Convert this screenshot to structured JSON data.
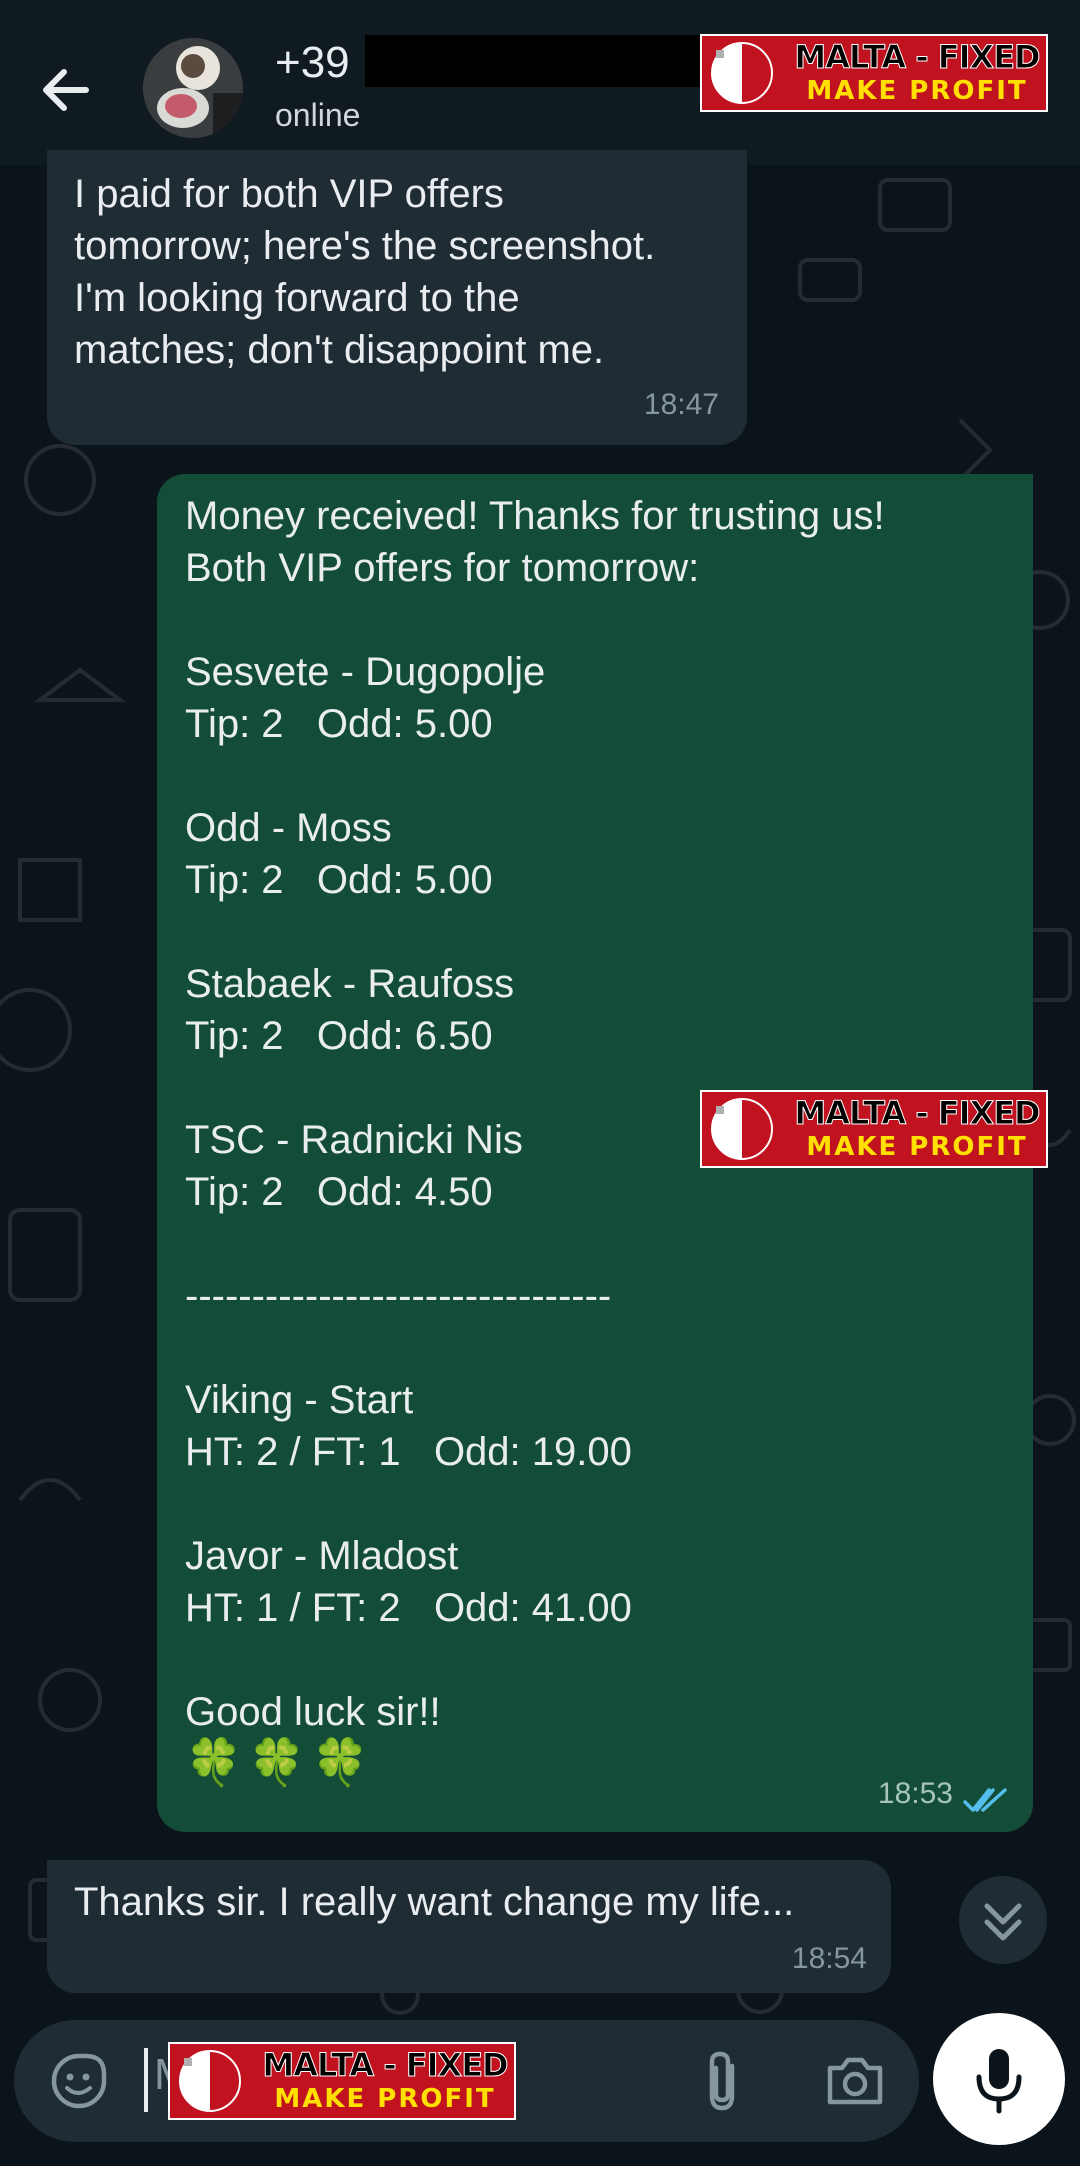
{
  "header": {
    "back_icon": "arrow-left-icon",
    "contact_name": "+39",
    "contact_status": "online"
  },
  "watermark": {
    "line1": "MALTA - FIXED",
    "line2": "MAKE PROFIT",
    "flag_colors": [
      "#ffffff",
      "#c1121f"
    ]
  },
  "messages": [
    {
      "direction": "incoming",
      "text": "I paid for both VIP offers\ntomorrow; here's the screenshot.\nI'm looking forward to the\nmatches; don't disappoint me.",
      "time": "18:47"
    },
    {
      "direction": "outgoing",
      "text": "Money received! Thanks for trusting us!\nBoth VIP offers for tomorrow:\n\nSesvete - Dugopolje\nTip: 2   Odd: 5.00\n\nOdd - Moss\nTip: 2   Odd: 5.00\n\nStabaek - Raufoss\nTip: 2   Odd: 6.50\n\nTSC - Radnicki Nis\nTip: 2   Odd: 4.50\n\n--------------------------------\n\nViking - Start\nHT: 2 / FT: 1   Odd: 19.00\n\nJavor - Mladost\nHT: 1 / FT: 2   Odd: 41.00\n\nGood luck sir!!",
      "emoji": "🍀🍀🍀",
      "time": "18:53",
      "status": "read",
      "status_color": "#53bdeb"
    },
    {
      "direction": "incoming",
      "text": "Thanks sir. I really want change my life...",
      "time": "18:54"
    }
  ],
  "composer": {
    "placeholder_visible": "M",
    "emoji_icon": "sticker-emoji-icon",
    "attach_icon": "paperclip-icon",
    "camera_icon": "camera-icon",
    "mic_icon": "microphone-icon"
  },
  "colors": {
    "background": "#0b141a",
    "header": "#0f1a21",
    "incoming_bubble": "#1f2c34",
    "outgoing_bubble": "#144d37",
    "watermark_red": "#c1121f",
    "watermark_yellow": "#ffe000"
  }
}
